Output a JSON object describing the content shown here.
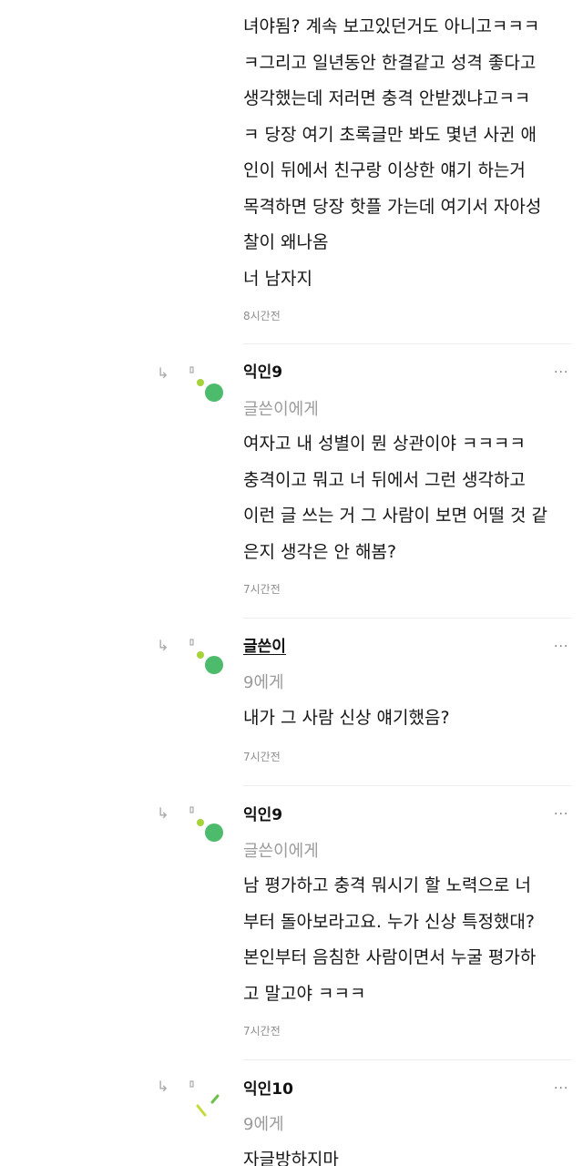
{
  "comment0": {
    "lines": [
      "녀야됨? 계속 보고있던거도 아니고ㅋㅋㅋ",
      "ㅋ그리고 일년동안 한결같고 성격 좋다고",
      "생각했는데 저러면 충격 안받겠냐고ㅋㅋ",
      "ㅋ 당장 여기 초록글만 봐도 몇년 사귄 애",
      "인이 뒤에서 친구랑 이상한 얘기 하는거",
      "목격하면 당장 핫플 가는데 여기서 자아성",
      "찰이 왜나옴",
      "너 남자지"
    ],
    "time": "8시간전"
  },
  "comment1": {
    "author": "익인9",
    "to": "글쓴이에게",
    "lines": [
      "여자고 내 성별이 뭔 상관이야 ㅋㅋㅋㅋ",
      "충격이고 뭐고 너 뒤에서 그런 생각하고",
      "이런 글 쓰는 거 그 사람이 보면 어떨 것 같",
      "은지 생각은 안 해봄?"
    ],
    "time": "7시간전"
  },
  "comment2": {
    "author": "글쓴이",
    "to": "9에게",
    "lines": [
      "내가 그 사람 신상 얘기했음?"
    ],
    "time": "7시간전"
  },
  "comment3": {
    "author": "익인9",
    "to": "글쓴이에게",
    "lines": [
      "남 평가하고 충격 뭐시기 할 노력으로 너",
      "부터 돌아보라고요. 누가 신상 특정했대?",
      "본인부터 음침한 사람이면서 누굴 평가하",
      "고 말고야 ㅋㅋㅋ"
    ],
    "time": "7시간전"
  },
  "comment4": {
    "author": "익인10",
    "to": "9에게",
    "lines": [
      "자글방하지마"
    ]
  },
  "icons": {
    "reply": "reply-arrow-icon",
    "more": "more-dots-icon",
    "avatar_green": "#4cbb6c",
    "avatar_lime": "#a6d23a",
    "more_glyph": "···",
    "reply_glyph": "↳"
  }
}
